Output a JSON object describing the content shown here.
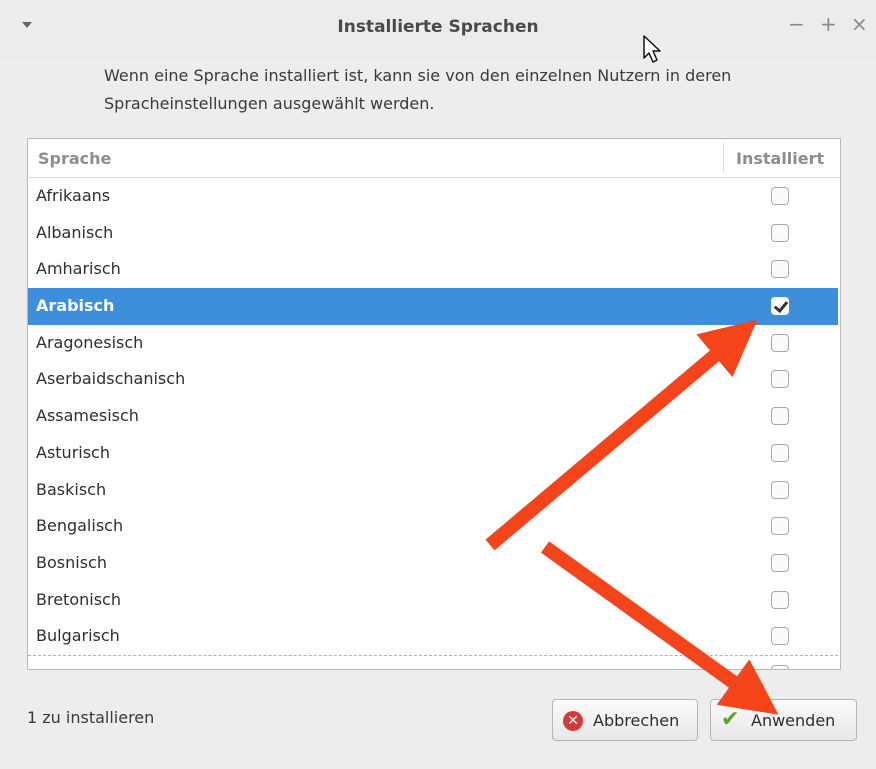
{
  "window": {
    "title": "Installierte Sprachen",
    "controls": {
      "minimize": "−",
      "maximize": "+",
      "close": "×"
    }
  },
  "description": "Wenn eine Sprache installiert ist, kann sie von den einzelnen Nutzern in deren Spracheinstellungen ausgewählt werden.",
  "table": {
    "columns": [
      "Sprache",
      "Installiert"
    ],
    "rows": [
      {
        "name": "Afrikaans",
        "installed": false
      },
      {
        "name": "Albanisch",
        "installed": false
      },
      {
        "name": "Amharisch",
        "installed": false
      },
      {
        "name": "Arabisch",
        "installed": true,
        "selected": true
      },
      {
        "name": "Aragonesisch",
        "installed": false
      },
      {
        "name": "Aserbaidschanisch",
        "installed": false
      },
      {
        "name": "Assamesisch",
        "installed": false
      },
      {
        "name": "Asturisch",
        "installed": false
      },
      {
        "name": "Baskisch",
        "installed": false
      },
      {
        "name": "Bengalisch",
        "installed": false
      },
      {
        "name": "Bosnisch",
        "installed": false
      },
      {
        "name": "Bretonisch",
        "installed": false
      },
      {
        "name": "Bulgarisch",
        "installed": false
      }
    ]
  },
  "status": "1 zu installieren",
  "buttons": {
    "cancel": "Abbrechen",
    "apply": "Anwenden"
  },
  "colors": {
    "selection": "#3d8fdc",
    "annotation_arrow": "#f5431a"
  },
  "icons": {
    "cancel": "x-circle-icon",
    "apply": "checkmark-icon",
    "menu": "chevron-down-icon"
  }
}
